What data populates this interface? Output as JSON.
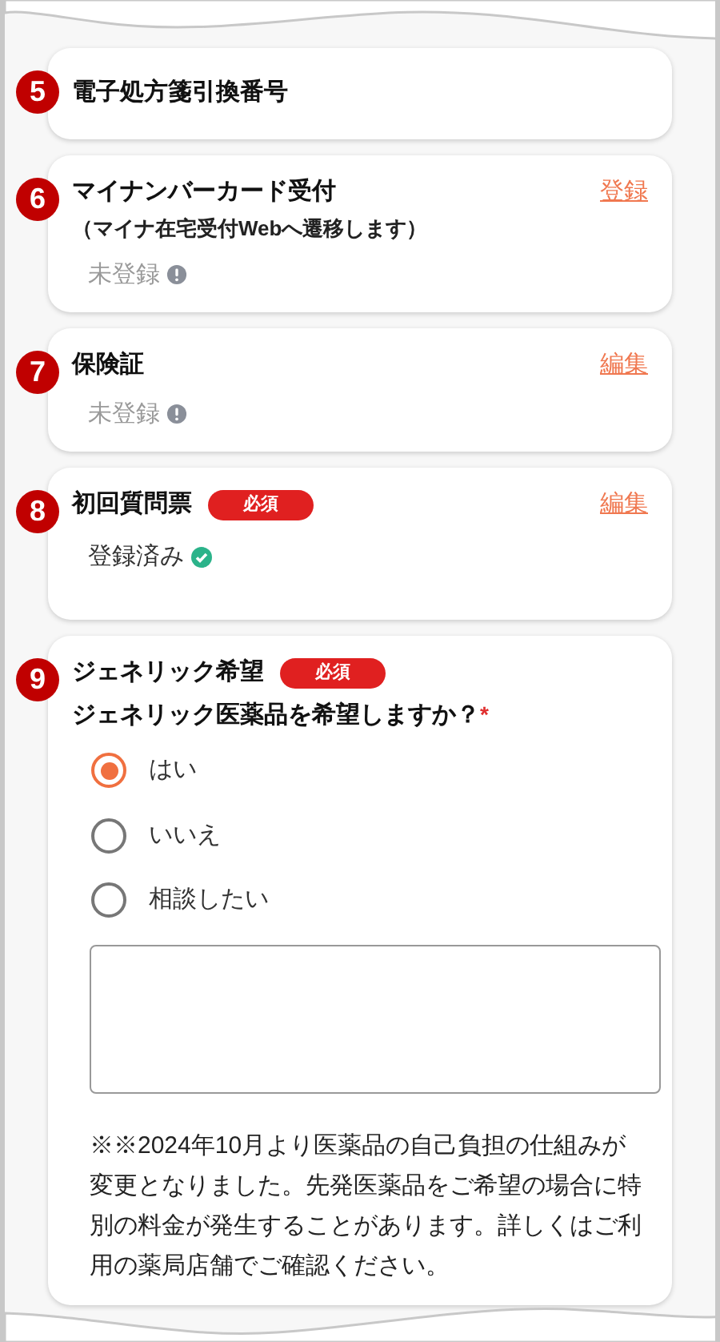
{
  "sections": [
    {
      "number": "5",
      "title": "電子処方箋引換番号"
    },
    {
      "number": "6",
      "title": "マイナンバーカード受付",
      "subtitle": "（マイナ在宅受付Webへ遷移します）",
      "action": "登録",
      "status": {
        "text": "未登録",
        "done": false
      }
    },
    {
      "number": "7",
      "title": "保険証",
      "action": "編集",
      "status": {
        "text": "未登録",
        "done": false
      }
    },
    {
      "number": "8",
      "title": "初回質問票",
      "badge": "必須",
      "action": "編集",
      "status": {
        "text": "登録済み",
        "done": true
      }
    },
    {
      "number": "9",
      "title": "ジェネリック希望",
      "badge": "必須",
      "question": "ジェネリック医薬品を希望しますか？",
      "required_mark": "*",
      "options": [
        {
          "label": "はい",
          "selected": true
        },
        {
          "label": "いいえ",
          "selected": false
        },
        {
          "label": "相談したい",
          "selected": false
        }
      ],
      "note": "※※2024年10月より医薬品の自己負担の仕組みが変更となりました。先発医薬品をご希望の場合に特別の料金が発生することがあります。詳しくはご利用の薬局店舗でご確認ください。"
    }
  ]
}
